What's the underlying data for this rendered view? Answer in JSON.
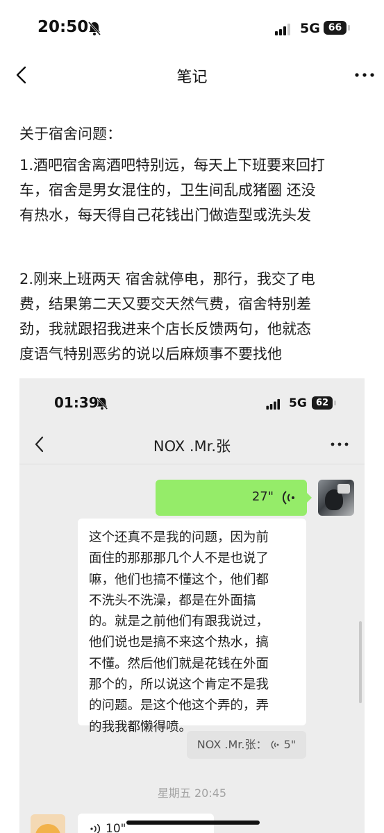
{
  "status_bar": {
    "time": "20:50",
    "network": "5G",
    "battery": "66"
  },
  "nav": {
    "title": "笔记"
  },
  "note": {
    "heading": "关于宿舍问题：",
    "paragraph1_lines": [
      "1.酒吧宿舍离酒吧特别远，每天上下班要来回打",
      "车，宿舍是男女混住的，卫生间乱成猪圈 还没",
      "有热水，每天得自己花钱出门做造型或洗头发"
    ],
    "paragraph2_lines": [
      "2.刚来上班两天 宿舍就停电，那行，我交了电",
      "费，结果第二天又要交天然气费，宿舍特别差",
      "劲，我就跟招我进来个店长反馈两句，他就态",
      "度语气特别恶劣的说以后麻烦事不要找他"
    ]
  },
  "screenshot": {
    "status_bar": {
      "time": "01:39",
      "network": "5G",
      "battery": "62"
    },
    "chat_title": "NOX .Mr.张",
    "outgoing_voice": {
      "duration": "27\""
    },
    "transcript_lines": [
      "这个还真不是我的问题，因为前",
      "面住的那那那几个人不是也说了",
      "嘛，他们也搞不懂这个，他们都",
      "不洗头不洗澡，都是在外面搞",
      "的。就是之前他们有跟我说过，",
      "他们说也是搞不来这个热水，搞",
      "不懂。然后他们就是花钱在外面",
      "那个的，所以说这个肯定不是我",
      "的问题。是这个他这个弄的，弄",
      "的我我都懒得喷。"
    ],
    "quoted_voice": {
      "sender": "NOX .Mr.张：",
      "duration": "5\""
    },
    "timestamp": "星期五 20:45",
    "incoming_voice": {
      "duration": "10\""
    }
  }
}
